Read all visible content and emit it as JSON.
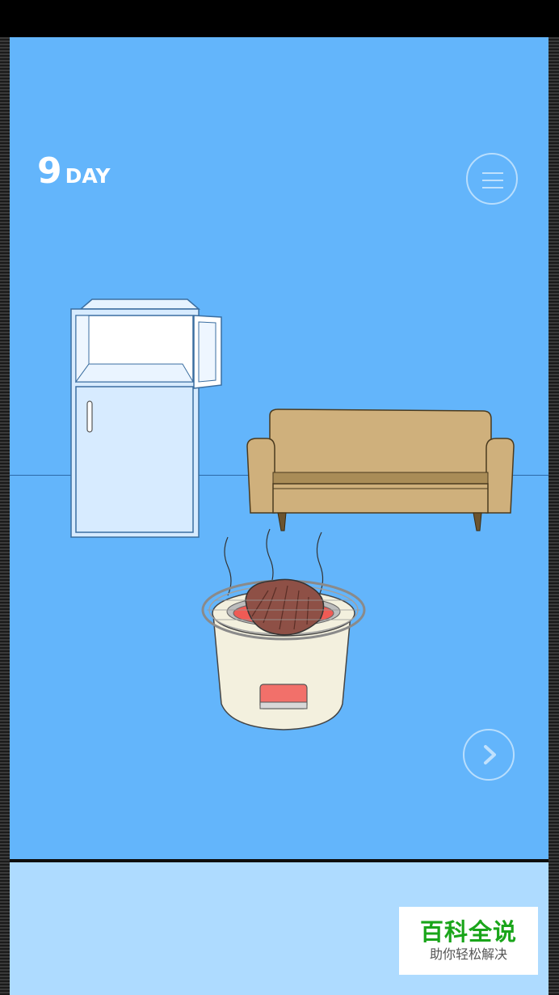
{
  "hud": {
    "day_number": "9",
    "day_label": "DAY",
    "menu_icon": "hamburger-icon",
    "next_icon": "chevron-right-icon"
  },
  "watermark": {
    "title": "百科全说",
    "subtitle": "助你轻松解决"
  },
  "colors": {
    "sky": "#63b5fb",
    "panel": "#aedbff",
    "sofa": "#cfb07c",
    "fridge": "#d7ebff",
    "watermark_green": "#1aa51a"
  }
}
